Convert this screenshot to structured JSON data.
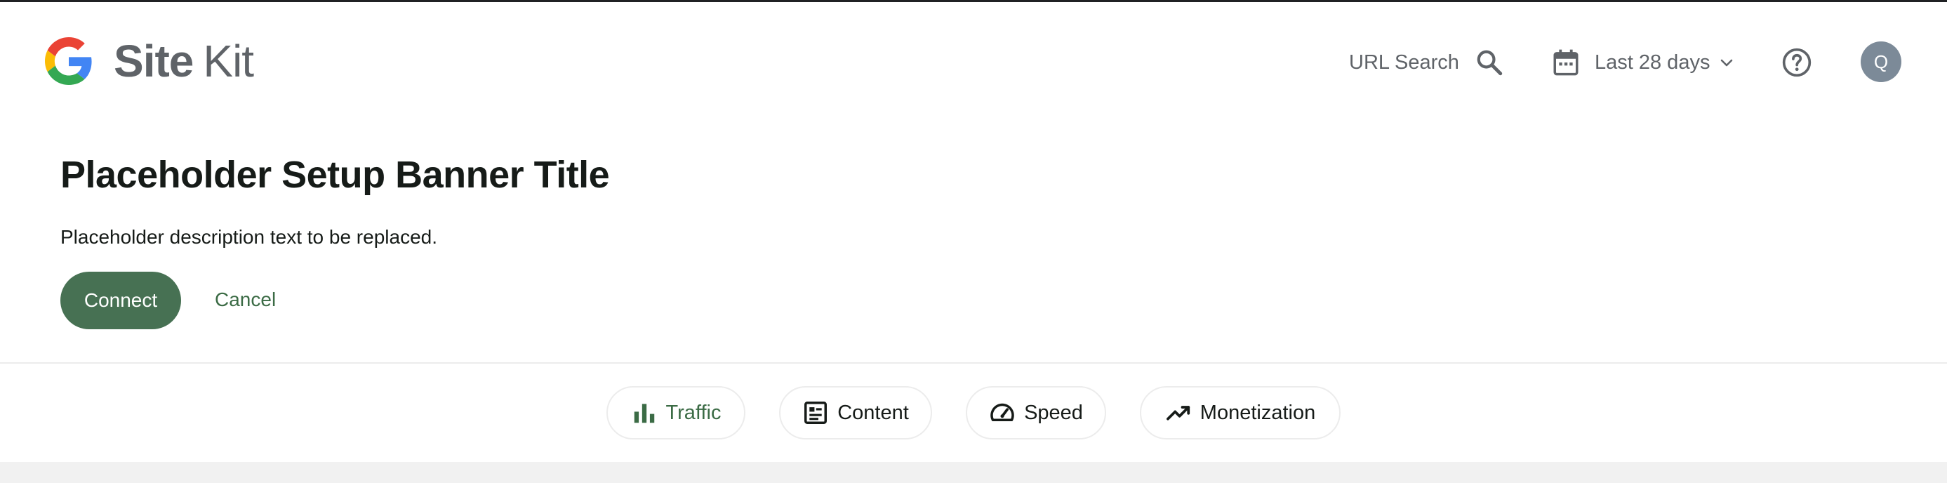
{
  "header": {
    "brand_site": "Site",
    "brand_kit": "Kit",
    "logo_icon": "google-g-icon",
    "url_search_label": "URL Search",
    "url_search_icon": "search-icon",
    "date_range_label": "Last 28 days",
    "date_range_icon": "calendar-icon",
    "help_icon": "help-circle-icon",
    "avatar_initial": "Q"
  },
  "banner": {
    "title": "Placeholder Setup Banner Title",
    "description": "Placeholder description text to be replaced.",
    "connect_label": "Connect",
    "cancel_label": "Cancel"
  },
  "tabs": [
    {
      "label": "Traffic",
      "icon": "bar-chart-icon",
      "active": true
    },
    {
      "label": "Content",
      "icon": "article-icon",
      "active": false
    },
    {
      "label": "Speed",
      "icon": "speedometer-icon",
      "active": false
    },
    {
      "label": "Monetization",
      "icon": "trending-up-icon",
      "active": false
    }
  ],
  "colors": {
    "accent": "#477153",
    "accent_text": "#3b6b45",
    "muted_text": "#5f6368",
    "avatar_bg": "#7c8a98",
    "divider": "#ececec"
  }
}
